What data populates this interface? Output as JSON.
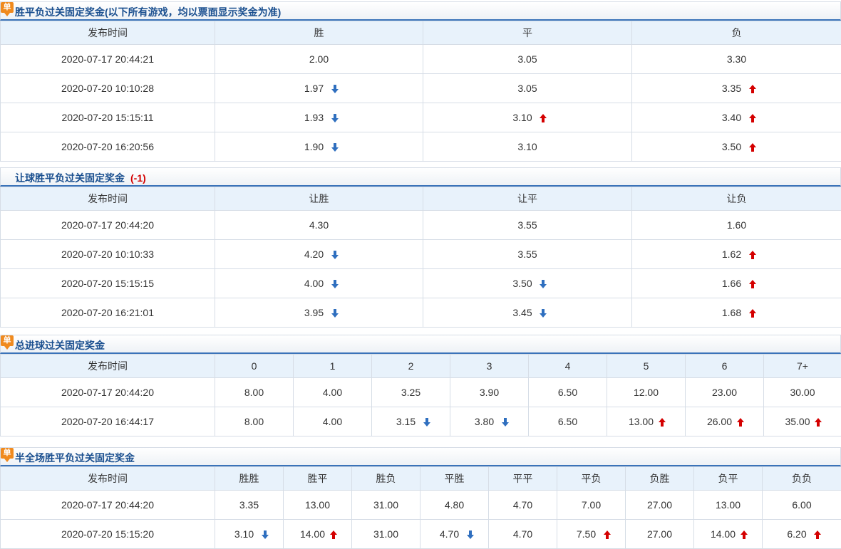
{
  "colors": {
    "accent": "#3a73b9",
    "up": "#d40000",
    "down": "#2f6fbf",
    "badge": "#f08a1e",
    "header_bg": "#e8f2fb"
  },
  "badge_label": "单",
  "sections": [
    {
      "title": "胜平负过关固定奖金(以下所有游戏，均以票面显示奖金为准)",
      "handicap": "",
      "columns": [
        "发布时间",
        "胜",
        "平",
        "负"
      ],
      "rows": [
        {
          "time": "2020-07-17 20:44:21",
          "cells": [
            {
              "v": "2.00",
              "d": ""
            },
            {
              "v": "3.05",
              "d": ""
            },
            {
              "v": "3.30",
              "d": ""
            }
          ]
        },
        {
          "time": "2020-07-20 10:10:28",
          "cells": [
            {
              "v": "1.97",
              "d": "down"
            },
            {
              "v": "3.05",
              "d": ""
            },
            {
              "v": "3.35",
              "d": "up"
            }
          ]
        },
        {
          "time": "2020-07-20 15:15:11",
          "cells": [
            {
              "v": "1.93",
              "d": "down"
            },
            {
              "v": "3.10",
              "d": "up"
            },
            {
              "v": "3.40",
              "d": "up"
            }
          ]
        },
        {
          "time": "2020-07-20 16:20:56",
          "cells": [
            {
              "v": "1.90",
              "d": "down"
            },
            {
              "v": "3.10",
              "d": ""
            },
            {
              "v": "3.50",
              "d": "up"
            }
          ]
        }
      ]
    },
    {
      "title": "让球胜平负过关固定奖金",
      "handicap": "(-1)",
      "columns": [
        "发布时间",
        "让胜",
        "让平",
        "让负"
      ],
      "rows": [
        {
          "time": "2020-07-17 20:44:20",
          "cells": [
            {
              "v": "4.30",
              "d": ""
            },
            {
              "v": "3.55",
              "d": ""
            },
            {
              "v": "1.60",
              "d": ""
            }
          ]
        },
        {
          "time": "2020-07-20 10:10:33",
          "cells": [
            {
              "v": "4.20",
              "d": "down"
            },
            {
              "v": "3.55",
              "d": ""
            },
            {
              "v": "1.62",
              "d": "up"
            }
          ]
        },
        {
          "time": "2020-07-20 15:15:15",
          "cells": [
            {
              "v": "4.00",
              "d": "down"
            },
            {
              "v": "3.50",
              "d": "down"
            },
            {
              "v": "1.66",
              "d": "up"
            }
          ]
        },
        {
          "time": "2020-07-20 16:21:01",
          "cells": [
            {
              "v": "3.95",
              "d": "down"
            },
            {
              "v": "3.45",
              "d": "down"
            },
            {
              "v": "1.68",
              "d": "up"
            }
          ]
        }
      ]
    },
    {
      "title": "总进球过关固定奖金",
      "handicap": "",
      "columns": [
        "发布时间",
        "0",
        "1",
        "2",
        "3",
        "4",
        "5",
        "6",
        "7+"
      ],
      "rows": [
        {
          "time": "2020-07-17 20:44:20",
          "cells": [
            {
              "v": "8.00",
              "d": ""
            },
            {
              "v": "4.00",
              "d": ""
            },
            {
              "v": "3.25",
              "d": ""
            },
            {
              "v": "3.90",
              "d": ""
            },
            {
              "v": "6.50",
              "d": ""
            },
            {
              "v": "12.00",
              "d": ""
            },
            {
              "v": "23.00",
              "d": ""
            },
            {
              "v": "30.00",
              "d": ""
            }
          ]
        },
        {
          "time": "2020-07-20 16:44:17",
          "cells": [
            {
              "v": "8.00",
              "d": ""
            },
            {
              "v": "4.00",
              "d": ""
            },
            {
              "v": "3.15",
              "d": "down"
            },
            {
              "v": "3.80",
              "d": "down"
            },
            {
              "v": "6.50",
              "d": ""
            },
            {
              "v": "13.00",
              "d": "up"
            },
            {
              "v": "26.00",
              "d": "up"
            },
            {
              "v": "35.00",
              "d": "up"
            }
          ]
        }
      ]
    },
    {
      "title": "半全场胜平负过关固定奖金",
      "handicap": "",
      "columns": [
        "发布时间",
        "胜胜",
        "胜平",
        "胜负",
        "平胜",
        "平平",
        "平负",
        "负胜",
        "负平",
        "负负"
      ],
      "rows": [
        {
          "time": "2020-07-17 20:44:20",
          "cells": [
            {
              "v": "3.35",
              "d": ""
            },
            {
              "v": "13.00",
              "d": ""
            },
            {
              "v": "31.00",
              "d": ""
            },
            {
              "v": "4.80",
              "d": ""
            },
            {
              "v": "4.70",
              "d": ""
            },
            {
              "v": "7.00",
              "d": ""
            },
            {
              "v": "27.00",
              "d": ""
            },
            {
              "v": "13.00",
              "d": ""
            },
            {
              "v": "6.00",
              "d": ""
            }
          ]
        },
        {
          "time": "2020-07-20 15:15:20",
          "cells": [
            {
              "v": "3.10",
              "d": "down"
            },
            {
              "v": "14.00",
              "d": "up"
            },
            {
              "v": "31.00",
              "d": ""
            },
            {
              "v": "4.70",
              "d": "down"
            },
            {
              "v": "4.70",
              "d": ""
            },
            {
              "v": "7.50",
              "d": "up"
            },
            {
              "v": "27.00",
              "d": ""
            },
            {
              "v": "14.00",
              "d": "up"
            },
            {
              "v": "6.20",
              "d": "up"
            }
          ]
        }
      ]
    }
  ]
}
